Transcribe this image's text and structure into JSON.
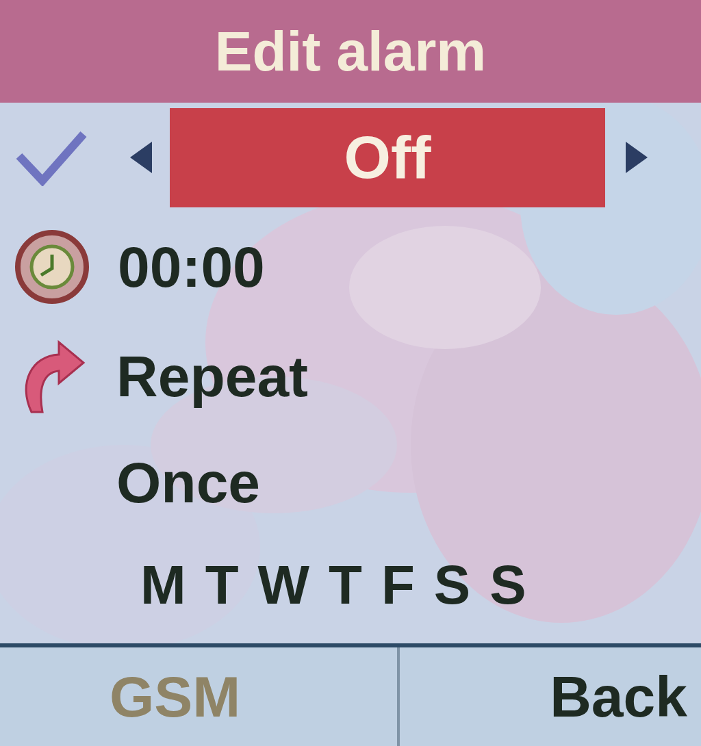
{
  "title": "Edit alarm",
  "selector": {
    "value": "Off"
  },
  "time": "00:00",
  "repeat_label": "Repeat",
  "repeat_value": "Once",
  "days": [
    "M",
    "T",
    "W",
    "T",
    "F",
    "S",
    "S"
  ],
  "softkeys": [
    {
      "label": "GSM",
      "disabled": true
    },
    {
      "label": "Back",
      "disabled": false
    }
  ]
}
